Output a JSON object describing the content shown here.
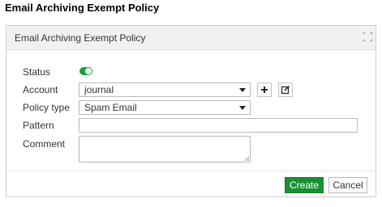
{
  "page": {
    "title": "Email Archiving Exempt Policy"
  },
  "dialog": {
    "title": "Email Archiving Exempt Policy",
    "fields": {
      "status": {
        "label": "Status",
        "enabled": true
      },
      "account": {
        "label": "Account",
        "value": "journal"
      },
      "policy_type": {
        "label": "Policy type",
        "value": "Spam Email"
      },
      "pattern": {
        "label": "Pattern",
        "value": ""
      },
      "comment": {
        "label": "Comment",
        "value": ""
      }
    },
    "buttons": {
      "create": "Create",
      "cancel": "Cancel"
    },
    "icons": {
      "maximize": "maximize-icon",
      "add": "plus-icon",
      "edit": "edit-icon"
    }
  },
  "colors": {
    "primary": "#1c8f34",
    "toggle_on": "#1e9d3e"
  }
}
